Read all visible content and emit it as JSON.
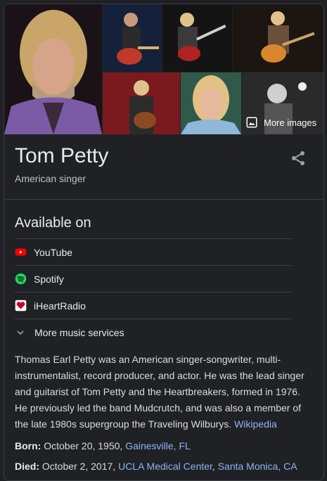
{
  "images": {
    "more_images_label": "More images"
  },
  "header": {
    "title": "Tom Petty",
    "subtitle": "American singer"
  },
  "available": {
    "heading": "Available on",
    "services": [
      {
        "name": "YouTube",
        "icon": "youtube-icon",
        "color": "#ff0000"
      },
      {
        "name": "Spotify",
        "icon": "spotify-icon",
        "color": "#1ed760"
      },
      {
        "name": "iHeartRadio",
        "icon": "iheartradio-icon",
        "color": "#c6002b"
      }
    ],
    "more_label": "More music services"
  },
  "description": {
    "text": "Thomas Earl Petty was an American singer-songwriter, multi-instrumentalist, record producer, and actor. He was the lead singer and guitarist of Tom Petty and the Heartbreakers, formed in 1976. He previously led the band Mudcrutch, and was also a member of the late 1980s supergroup the Traveling Wilburys.",
    "source": "Wikipedia"
  },
  "facts": {
    "born_label": "Born:",
    "born_text": "October 20, 1950,",
    "born_place": "Gainesville, FL",
    "died_label": "Died:",
    "died_text": "October 2, 2017,",
    "died_place1": "UCLA Medical Center",
    "died_sep": ", ",
    "died_place2": "Santa Monica, CA"
  },
  "colors": {
    "background": "#202124",
    "link": "#8ab4f8",
    "divider": "#3c4043"
  }
}
